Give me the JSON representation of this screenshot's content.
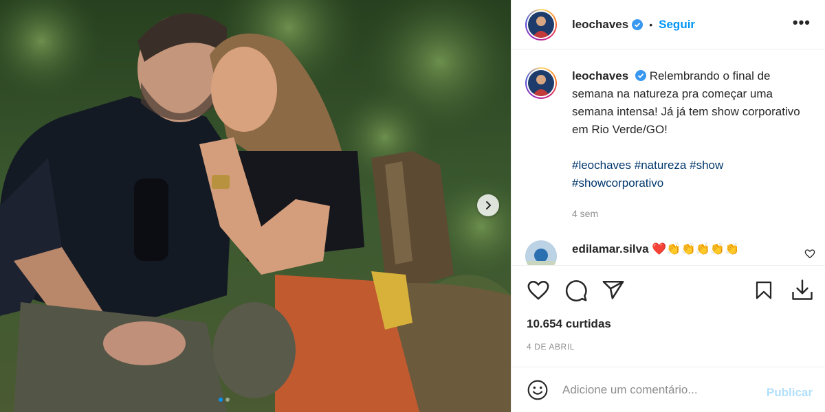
{
  "post": {
    "username": "leochaves",
    "follow_label": "Seguir",
    "separator": "•",
    "more_label": "•••",
    "caption": "Relembrando o final de semana na natureza pra começar uma semana intensa! Já já tem show corporativo em Rio Verde/GO!",
    "hashtags": [
      "#leochaves",
      "#natureza",
      "#show",
      "#showcorporativo"
    ],
    "time_ago": "4 sem",
    "likes": "10.654 curtidas",
    "date": "4 DE ABRIL"
  },
  "comment": {
    "username": "edilamar.silva",
    "text": "❤️👏👏👏👏👏"
  },
  "comment_box": {
    "placeholder": "Adicione um comentário...",
    "publish_label": "Publicar"
  },
  "carousel": {
    "total_slides": 2,
    "current_slide": 1
  },
  "colors": {
    "accent": "#0095f6",
    "hashtag": "#00376b",
    "muted": "#8e8e8e",
    "publish_disabled": "#b2dffc",
    "verified": "#3897f0"
  },
  "icons": {
    "verified": "verified-badge-icon",
    "like": "heart-icon",
    "comment": "comment-bubble-icon",
    "share": "paper-plane-icon",
    "save": "bookmark-icon",
    "download": "download-icon",
    "emoji": "smiley-icon",
    "next": "chevron-right-icon"
  }
}
